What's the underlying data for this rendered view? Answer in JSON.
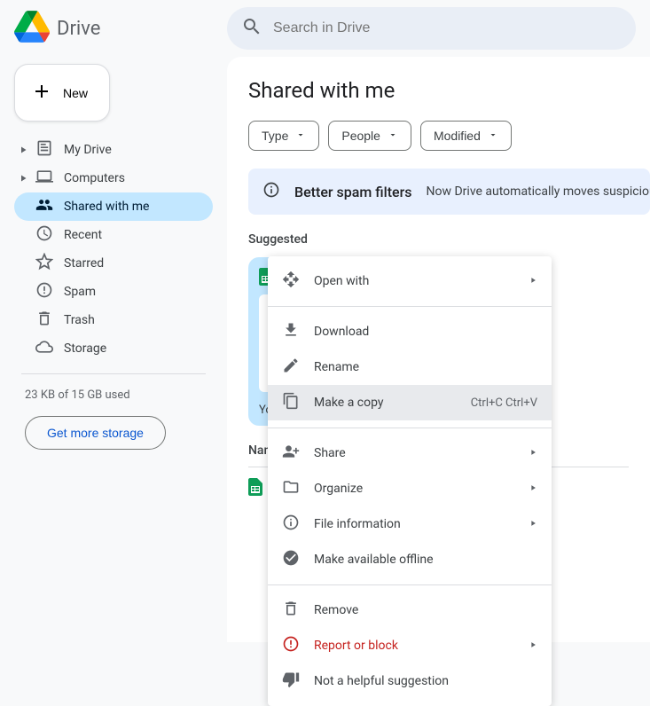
{
  "app": {
    "name": "Drive"
  },
  "search": {
    "placeholder": "Search in Drive"
  },
  "sidebar": {
    "new_label": "New",
    "items": [
      {
        "label": "My Drive",
        "icon": "my-drive-icon",
        "expandable": true
      },
      {
        "label": "Computers",
        "icon": "computers-icon",
        "expandable": true
      },
      {
        "label": "Shared with me",
        "icon": "shared-icon",
        "active": true
      },
      {
        "label": "Recent",
        "icon": "recent-icon"
      },
      {
        "label": "Starred",
        "icon": "starred-icon"
      },
      {
        "label": "Spam",
        "icon": "spam-icon"
      },
      {
        "label": "Trash",
        "icon": "trash-icon"
      },
      {
        "label": "Storage",
        "icon": "storage-icon"
      }
    ],
    "storage_used": "23 KB of 15 GB used",
    "storage_cta": "Get more storage"
  },
  "main": {
    "title": "Shared with me",
    "filters": [
      {
        "label": "Type"
      },
      {
        "label": "People"
      },
      {
        "label": "Modified"
      }
    ],
    "banner": {
      "title": "Better spam filters",
      "text": "Now Drive automatically moves suspicious"
    },
    "suggested_label": "Suggested",
    "suggested_footer": "Yo",
    "name_header": "Name"
  },
  "context_menu": {
    "items": [
      {
        "label": "Open with",
        "icon": "open-with-icon",
        "submenu": true
      },
      {
        "sep": true
      },
      {
        "label": "Download",
        "icon": "download-icon"
      },
      {
        "label": "Rename",
        "icon": "rename-icon"
      },
      {
        "label": "Make a copy",
        "icon": "copy-icon",
        "shortcut": "Ctrl+C Ctrl+V",
        "hover": true
      },
      {
        "sep": true
      },
      {
        "label": "Share",
        "icon": "share-icon",
        "submenu": true
      },
      {
        "label": "Organize",
        "icon": "organize-icon",
        "submenu": true
      },
      {
        "label": "File information",
        "icon": "info-icon",
        "submenu": true
      },
      {
        "label": "Make available offline",
        "icon": "offline-icon"
      },
      {
        "sep": true
      },
      {
        "label": "Remove",
        "icon": "remove-icon"
      },
      {
        "label": "Report or block",
        "icon": "report-icon",
        "submenu": true,
        "danger": true
      },
      {
        "label": "Not a helpful suggestion",
        "icon": "thumbs-down-icon"
      }
    ]
  }
}
